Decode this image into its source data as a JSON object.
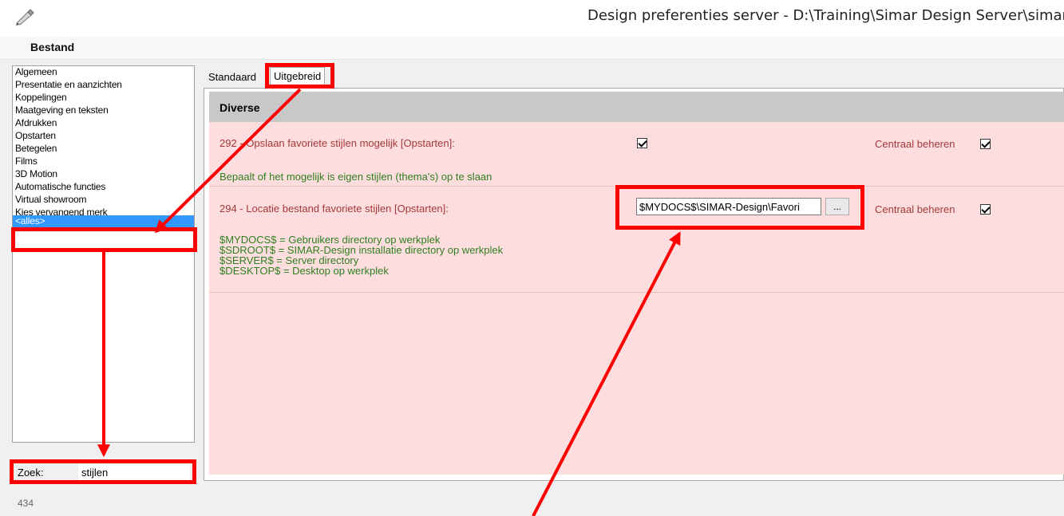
{
  "window": {
    "title": "Design preferenties server - D:\\Training\\Simar Design Server\\simarC",
    "icon": "pen-icon"
  },
  "menu": {
    "items": [
      "Bestand"
    ]
  },
  "categories": {
    "items": [
      "Algemeen",
      "Presentatie en aanzichten",
      "Koppelingen",
      "Maatgeving en teksten",
      "Afdrukken",
      "Opstarten",
      "Betegelen",
      "Films",
      "3D Motion",
      "Automatische functies",
      "Virtual showroom",
      "Kies vervangend merk",
      "<alles>"
    ],
    "selected": "<alles>"
  },
  "search": {
    "label": "Zoek:",
    "value": "stijlen"
  },
  "count": "434",
  "tabs": {
    "standaard": "Standaard",
    "uitgebreid": "Uitgebreid",
    "active": "Uitgebreid"
  },
  "section": {
    "title": "Diverse"
  },
  "prefs": [
    {
      "label": "292 - Opslaan favoriete stijlen mogelijk [Opstarten]:",
      "checked": true,
      "central_label": "Centraal beheren",
      "central_checked": true,
      "description": "Bepaalt of het mogelijk is eigen stijlen (thema's) op te slaan"
    },
    {
      "label": "294 - Locatie bestand favoriete stijlen [Opstarten]:",
      "value": "$MYDOCS$\\SIMAR-Design\\Favori",
      "browse_label": "...",
      "central_label": "Centraal beheren",
      "central_checked": true,
      "description_lines": [
        "$MYDOCS$ = Gebruikers directory op werkplek",
        "$SDROOT$ = SIMAR-Design installatie directory op werkplek",
        "$SERVER$ = Server directory",
        "$DESKTOP$ = Desktop op werkplek"
      ]
    }
  ],
  "colors": {
    "annotation": "#ff0000",
    "selection": "#3399ff",
    "content_bg": "#fddddd",
    "label": "#a33a3a",
    "description": "#2f7f22"
  }
}
